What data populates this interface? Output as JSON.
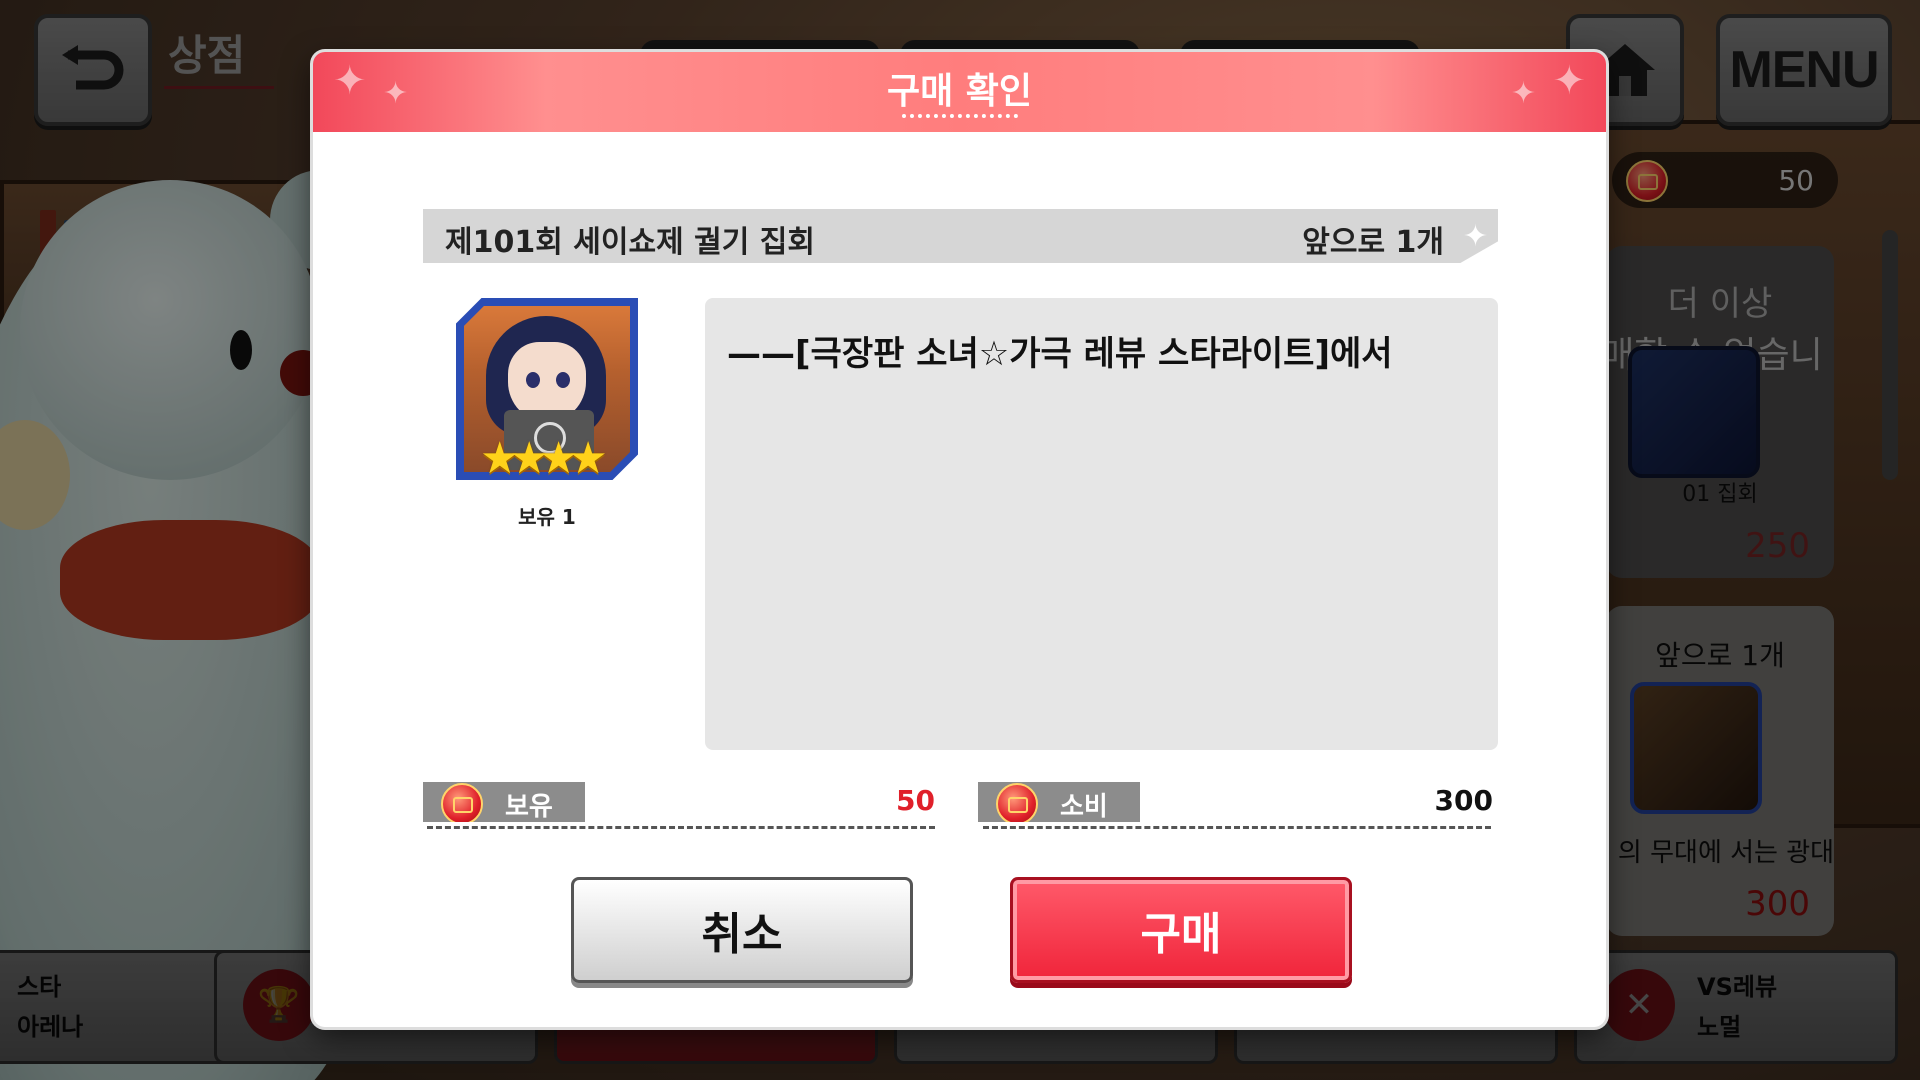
{
  "header": {
    "shop_title": "상점",
    "menu_label": "MENU"
  },
  "side_panel": {
    "currency_value": "50",
    "soldout_card": {
      "line1": "더 이상",
      "line2": "매할 수 없습니다.",
      "name_fragment": "01        집회",
      "price": "250"
    },
    "next_card": {
      "remaining": "앞으로 1개",
      "name": "의 무대에 서는 광대",
      "price": "300"
    }
  },
  "bottom_tabs": {
    "star_arena_line1": "스타",
    "star_arena_line2": "아레나",
    "vs_revue_line1": "VS레뷰",
    "vs_revue_line2": "노멀"
  },
  "dialog": {
    "title": "구매 확인",
    "item_name": "제101회 세이쇼제 궐기 집회",
    "item_remaining": "앞으로 1개",
    "rarity_stars": "★★★★",
    "owned_count": "보유 1",
    "description": "——[극장판 소녀☆가극 레뷰 스타라이트]에서",
    "owned_label": "보유",
    "owned_value": "50",
    "cost_label": "소비",
    "cost_value": "300",
    "cancel_label": "취소",
    "buy_label": "구매"
  },
  "colors": {
    "accent": "#f0243a",
    "header_gradient": "#ff7d7d",
    "owned_value_color": "#e0202a"
  }
}
